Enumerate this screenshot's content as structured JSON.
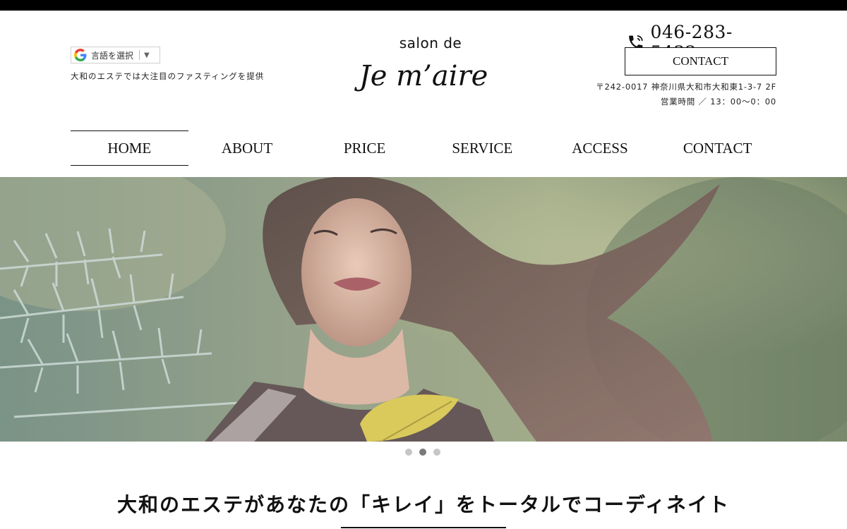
{
  "header": {
    "language_select_label": "言語を選択",
    "language_select_arrow": "▼",
    "tagline": "大和のエステでは大注目のファスティングを提供",
    "logo_sub": "salon de",
    "logo_main": "Je m’aire",
    "phone": "046-283-5432",
    "contact_button": "CONTACT",
    "address": "〒242-0017 神奈川県大和市大和東1-3-7 2F",
    "hours": "営業時間 ／ 13：00〜0：00"
  },
  "nav": {
    "items": [
      {
        "label": "HOME",
        "active": true
      },
      {
        "label": "ABOUT"
      },
      {
        "label": "PRICE"
      },
      {
        "label": "SERVICE"
      },
      {
        "label": "ACCESS"
      },
      {
        "label": "CONTACT"
      }
    ]
  },
  "slider": {
    "slide_count": 3,
    "active_index": 1
  },
  "main": {
    "section_title": "大和のエステがあなたの「キレイ」をトータルでコーディネイト"
  },
  "colors": {
    "topbar": "#000000",
    "text": "#111111",
    "dot_active": "#7a7a7a",
    "dot_inactive": "#c6c6c6"
  },
  "icons": [
    "google-icon",
    "phone-icon",
    "chevron-down-icon"
  ]
}
